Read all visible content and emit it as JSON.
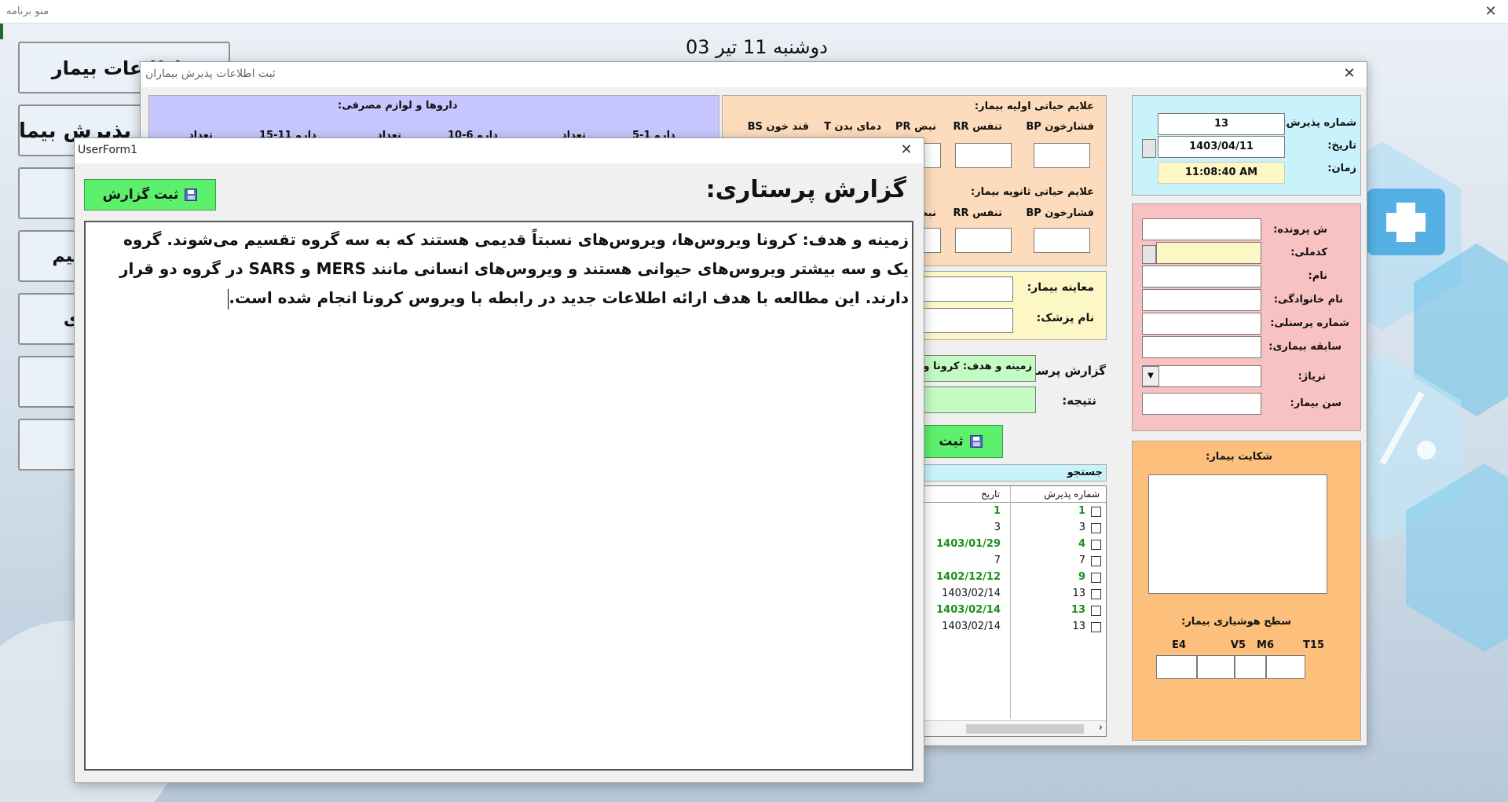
{
  "app": {
    "title": "منو برنامه",
    "date_header": "دوشنبه 11 تیر 03"
  },
  "menu": {
    "items": [
      "ثبت اطلاعات بیمار",
      "پذیرش بیمار",
      "",
      "بیم",
      "ی",
      "",
      ""
    ]
  },
  "admission": {
    "title": "ثبت اطلاعات پذیرش بیماران",
    "meds": {
      "title": "داروها و لوازم مصرفی:",
      "headers": [
        "تعداد",
        "دارو 1-5",
        "تعداد",
        "دارو 6-10",
        "تعداد",
        "دارو 11-15",
        "تعداد"
      ]
    },
    "vitals1": {
      "title": "علایم حیاتی اولیه بیمار:",
      "labels": [
        "فشارخون BP",
        "تنفس RR",
        "نبض PR",
        "دمای بدن T",
        "قند خون BS"
      ]
    },
    "vitals2": {
      "title": "علایم حیاتی ثانویه بیمار:",
      "labels": [
        "فشارخون BP",
        "تنفس RR",
        "نبض"
      ]
    },
    "exam_label": "معاینه بیمار:",
    "doctor_label": "نام پزشک:",
    "report_label": "گزارش پرستار:",
    "report_value": "زمینه و هدف: کرونا ویروس",
    "result_label": "نتیجه:",
    "save_button": "ثبت",
    "admission_no_label": "شماره پذیرش:",
    "admission_no_value": "13",
    "date_label": "تاریخ:",
    "date_value": "1403/04/11",
    "time_label": "زمان:",
    "time_value": "11:08:40 AM",
    "patient_labels": [
      "ش پرونده:",
      "کدملی:",
      "نام:",
      "نام خانوادگی:",
      "شماره پرسنلی:",
      "سابقه بیماری:",
      "تریاژ:",
      "سن بیمار:"
    ],
    "complaint_label": "شکایت بیمار:",
    "consciousness_label": "سطح هوشیاری بیمار:",
    "gcs": [
      "T15",
      "M6",
      "V5",
      "E4"
    ],
    "search_label": "جستجو",
    "list": {
      "headers": [
        "شماره پذیرش",
        "تاریخ"
      ],
      "rows": [
        {
          "no": "1",
          "date": "1",
          "green": true
        },
        {
          "no": "3",
          "date": "3",
          "green": false
        },
        {
          "no": "4",
          "date": "1403/01/29",
          "green": true
        },
        {
          "no": "7",
          "date": "7",
          "green": false
        },
        {
          "no": "9",
          "date": "1402/12/12",
          "green": true
        },
        {
          "no": "13",
          "date": "1403/02/14",
          "green": false
        },
        {
          "no": "13",
          "date": "1403/02/14",
          "green": true
        },
        {
          "no": "13",
          "date": "1403/02/14",
          "green": false
        }
      ]
    }
  },
  "userform": {
    "title": "UserForm1",
    "heading": "گزارش پرستاری:",
    "save_button": "ثبت گزارش",
    "report_text": "زمینه و هدف: کرونا ویروس‌ها، ویروس‌های نسبتاً قدیمی هستند که به سه گروه تقسیم می‌شوند. گروه یک و سه بیشتر ویروس‌های حیوانی هستند و ویروس‌های انسانی مانند MERS و SARS در گروه دو قرار دارند. این مطالعه با هدف ارائه اطلاعات جدید در رابطه با ویروس کرونا انجام شده است."
  },
  "colors": {
    "lavender": "#c8c6ff",
    "peach": "#fcdcbc",
    "pink": "#f8c2c2",
    "cyan": "#c9f3fb",
    "orange": "#fcc07c",
    "yellow_light": "#fcf7c4",
    "green_light": "#c3fbc3",
    "green_button": "#5df06d"
  }
}
